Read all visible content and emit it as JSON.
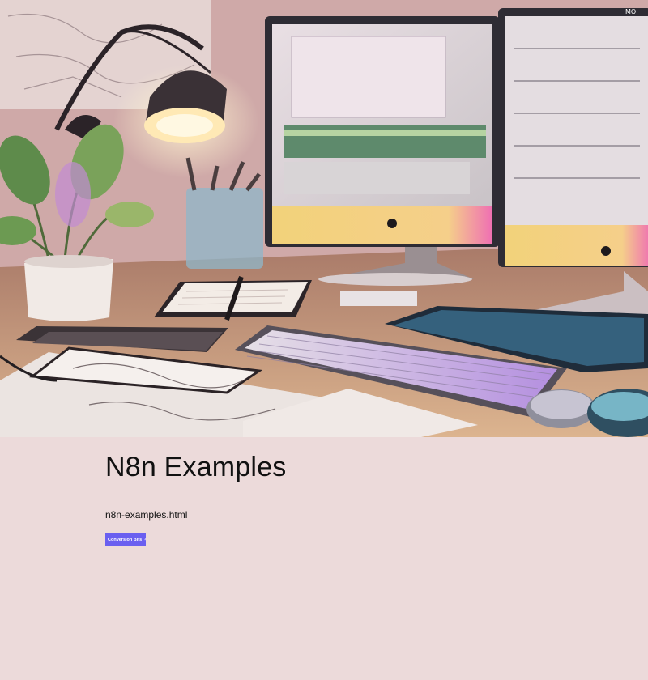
{
  "hero": {
    "monitor_label": "MO"
  },
  "page": {
    "title": "N8n Examples",
    "link_text": "n8n-examples.html",
    "badge_label": "Conversion Bits"
  },
  "colors": {
    "background": "#ecdada",
    "badge_background": "#6a5ff0",
    "text": "#111111"
  },
  "icons": {
    "badge_icon": "lightning-bolt-icon"
  }
}
